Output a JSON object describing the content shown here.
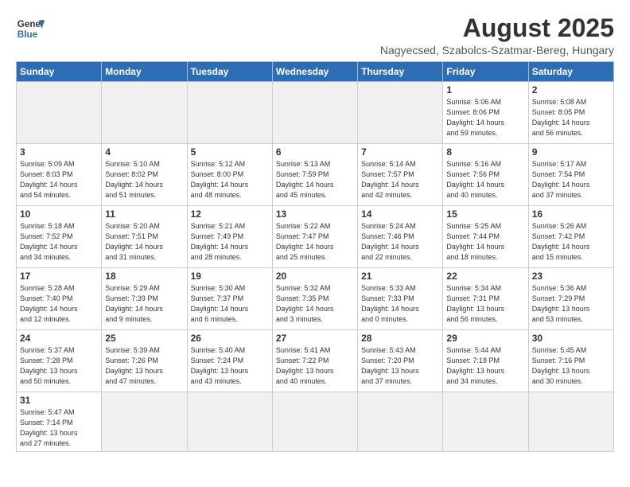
{
  "header": {
    "logo_general": "General",
    "logo_blue": "Blue",
    "title": "August 2025",
    "subtitle": "Nagyecsed, Szabolcs-Szatmar-Bereg, Hungary"
  },
  "days_of_week": [
    "Sunday",
    "Monday",
    "Tuesday",
    "Wednesday",
    "Thursday",
    "Friday",
    "Saturday"
  ],
  "weeks": [
    [
      {
        "day": "",
        "info": ""
      },
      {
        "day": "",
        "info": ""
      },
      {
        "day": "",
        "info": ""
      },
      {
        "day": "",
        "info": ""
      },
      {
        "day": "",
        "info": ""
      },
      {
        "day": "1",
        "info": "Sunrise: 5:06 AM\nSunset: 8:06 PM\nDaylight: 14 hours\nand 59 minutes."
      },
      {
        "day": "2",
        "info": "Sunrise: 5:08 AM\nSunset: 8:05 PM\nDaylight: 14 hours\nand 56 minutes."
      }
    ],
    [
      {
        "day": "3",
        "info": "Sunrise: 5:09 AM\nSunset: 8:03 PM\nDaylight: 14 hours\nand 54 minutes."
      },
      {
        "day": "4",
        "info": "Sunrise: 5:10 AM\nSunset: 8:02 PM\nDaylight: 14 hours\nand 51 minutes."
      },
      {
        "day": "5",
        "info": "Sunrise: 5:12 AM\nSunset: 8:00 PM\nDaylight: 14 hours\nand 48 minutes."
      },
      {
        "day": "6",
        "info": "Sunrise: 5:13 AM\nSunset: 7:59 PM\nDaylight: 14 hours\nand 45 minutes."
      },
      {
        "day": "7",
        "info": "Sunrise: 5:14 AM\nSunset: 7:57 PM\nDaylight: 14 hours\nand 42 minutes."
      },
      {
        "day": "8",
        "info": "Sunrise: 5:16 AM\nSunset: 7:56 PM\nDaylight: 14 hours\nand 40 minutes."
      },
      {
        "day": "9",
        "info": "Sunrise: 5:17 AM\nSunset: 7:54 PM\nDaylight: 14 hours\nand 37 minutes."
      }
    ],
    [
      {
        "day": "10",
        "info": "Sunrise: 5:18 AM\nSunset: 7:52 PM\nDaylight: 14 hours\nand 34 minutes."
      },
      {
        "day": "11",
        "info": "Sunrise: 5:20 AM\nSunset: 7:51 PM\nDaylight: 14 hours\nand 31 minutes."
      },
      {
        "day": "12",
        "info": "Sunrise: 5:21 AM\nSunset: 7:49 PM\nDaylight: 14 hours\nand 28 minutes."
      },
      {
        "day": "13",
        "info": "Sunrise: 5:22 AM\nSunset: 7:47 PM\nDaylight: 14 hours\nand 25 minutes."
      },
      {
        "day": "14",
        "info": "Sunrise: 5:24 AM\nSunset: 7:46 PM\nDaylight: 14 hours\nand 22 minutes."
      },
      {
        "day": "15",
        "info": "Sunrise: 5:25 AM\nSunset: 7:44 PM\nDaylight: 14 hours\nand 18 minutes."
      },
      {
        "day": "16",
        "info": "Sunrise: 5:26 AM\nSunset: 7:42 PM\nDaylight: 14 hours\nand 15 minutes."
      }
    ],
    [
      {
        "day": "17",
        "info": "Sunrise: 5:28 AM\nSunset: 7:40 PM\nDaylight: 14 hours\nand 12 minutes."
      },
      {
        "day": "18",
        "info": "Sunrise: 5:29 AM\nSunset: 7:39 PM\nDaylight: 14 hours\nand 9 minutes."
      },
      {
        "day": "19",
        "info": "Sunrise: 5:30 AM\nSunset: 7:37 PM\nDaylight: 14 hours\nand 6 minutes."
      },
      {
        "day": "20",
        "info": "Sunrise: 5:32 AM\nSunset: 7:35 PM\nDaylight: 14 hours\nand 3 minutes."
      },
      {
        "day": "21",
        "info": "Sunrise: 5:33 AM\nSunset: 7:33 PM\nDaylight: 14 hours\nand 0 minutes."
      },
      {
        "day": "22",
        "info": "Sunrise: 5:34 AM\nSunset: 7:31 PM\nDaylight: 13 hours\nand 56 minutes."
      },
      {
        "day": "23",
        "info": "Sunrise: 5:36 AM\nSunset: 7:29 PM\nDaylight: 13 hours\nand 53 minutes."
      }
    ],
    [
      {
        "day": "24",
        "info": "Sunrise: 5:37 AM\nSunset: 7:28 PM\nDaylight: 13 hours\nand 50 minutes."
      },
      {
        "day": "25",
        "info": "Sunrise: 5:39 AM\nSunset: 7:26 PM\nDaylight: 13 hours\nand 47 minutes."
      },
      {
        "day": "26",
        "info": "Sunrise: 5:40 AM\nSunset: 7:24 PM\nDaylight: 13 hours\nand 43 minutes."
      },
      {
        "day": "27",
        "info": "Sunrise: 5:41 AM\nSunset: 7:22 PM\nDaylight: 13 hours\nand 40 minutes."
      },
      {
        "day": "28",
        "info": "Sunrise: 5:43 AM\nSunset: 7:20 PM\nDaylight: 13 hours\nand 37 minutes."
      },
      {
        "day": "29",
        "info": "Sunrise: 5:44 AM\nSunset: 7:18 PM\nDaylight: 13 hours\nand 34 minutes."
      },
      {
        "day": "30",
        "info": "Sunrise: 5:45 AM\nSunset: 7:16 PM\nDaylight: 13 hours\nand 30 minutes."
      }
    ],
    [
      {
        "day": "31",
        "info": "Sunrise: 5:47 AM\nSunset: 7:14 PM\nDaylight: 13 hours\nand 27 minutes."
      },
      {
        "day": "",
        "info": ""
      },
      {
        "day": "",
        "info": ""
      },
      {
        "day": "",
        "info": ""
      },
      {
        "day": "",
        "info": ""
      },
      {
        "day": "",
        "info": ""
      },
      {
        "day": "",
        "info": ""
      }
    ]
  ]
}
